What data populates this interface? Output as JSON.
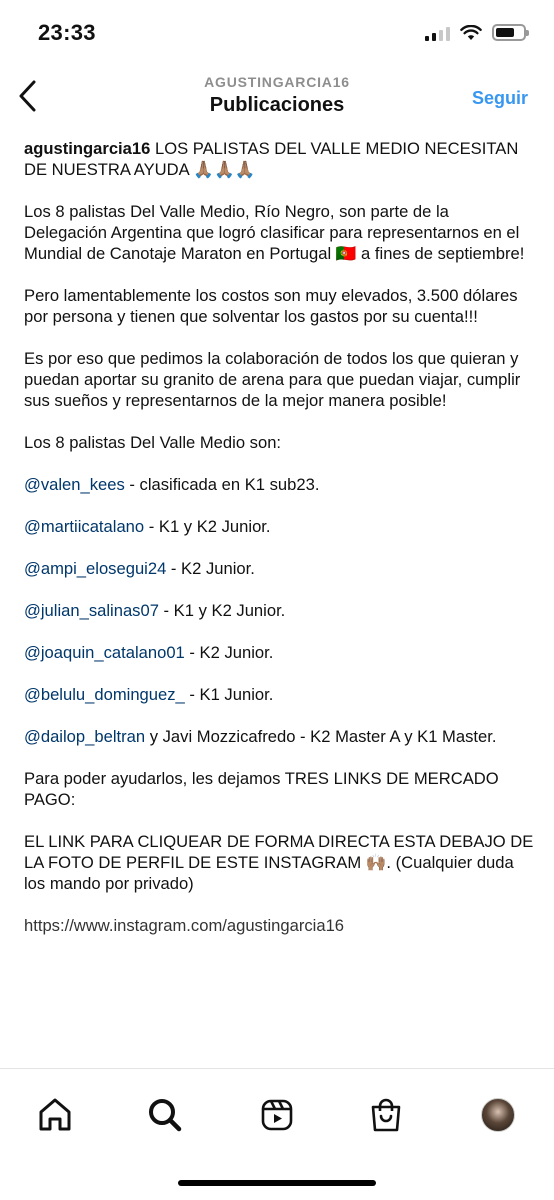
{
  "status_bar": {
    "time": "23:33",
    "icons": [
      "signal-icon",
      "wifi-icon",
      "battery-icon"
    ]
  },
  "header": {
    "username": "AGUSTINGARCIA16",
    "title": "Publicaciones",
    "follow_label": "Seguir",
    "back_icon": "chevron-left-icon"
  },
  "caption": {
    "author": "agustingarcia16",
    "intro": " LOS PALISTAS DEL VALLE MEDIO NECESITAN DE NUESTRA AYUDA 🙏🏽🙏🏽🙏🏽",
    "p1": "Los 8 palistas Del Valle Medio, Río Negro, son parte de la Delegación Argentina que logró clasificar para representarnos en el Mundial de Canotaje Maraton en Portugal 🇵🇹 a fines de septiembre!",
    "p2": "Pero lamentablemente los costos son muy elevados, 3.500 dólares por persona y tienen que solventar los gastos por su cuenta!!!",
    "p3": "Es por eso que pedimos la colaboración de todos los que quieran y puedan aportar su granito de arena para que puedan viajar, cumplir sus sueños y representarnos de la mejor manera posible!",
    "p4": "Los 8 palistas Del Valle Medio son:",
    "athletes": [
      {
        "mention": "@valen_kees",
        "text": " - clasificada en K1 sub23."
      },
      {
        "mention": "@martiicatalano",
        "text": " - K1 y K2 Junior."
      },
      {
        "mention": "@ampi_elosegui24",
        "text": " - K2 Junior."
      },
      {
        "mention": "@julian_salinas07",
        "text": " - K1 y K2 Junior."
      },
      {
        "mention": "@joaquin_catalano01",
        "text": " - K2 Junior."
      },
      {
        "mention": "@belulu_dominguez_",
        "text": " - K1 Junior."
      },
      {
        "mention": "@dailop_beltran",
        "text": " y Javi Mozzicafredo - K2 Master A y K1 Master."
      }
    ],
    "p5": "Para poder ayudarlos, les dejamos TRES LINKS DE MERCADO PAGO:",
    "p6": "EL LINK PARA CLIQUEAR DE FORMA DIRECTA ESTA DEBAJO DE LA FOTO DE PERFIL DE ESTE INSTAGRAM 🙌🏽. (Cualquier duda los mando por privado)",
    "cut_line": "https://www.instagram.com/agustingarcia16"
  },
  "tab_bar": {
    "items": [
      "home-icon",
      "search-icon",
      "reels-icon",
      "shop-icon",
      "profile-avatar"
    ]
  }
}
